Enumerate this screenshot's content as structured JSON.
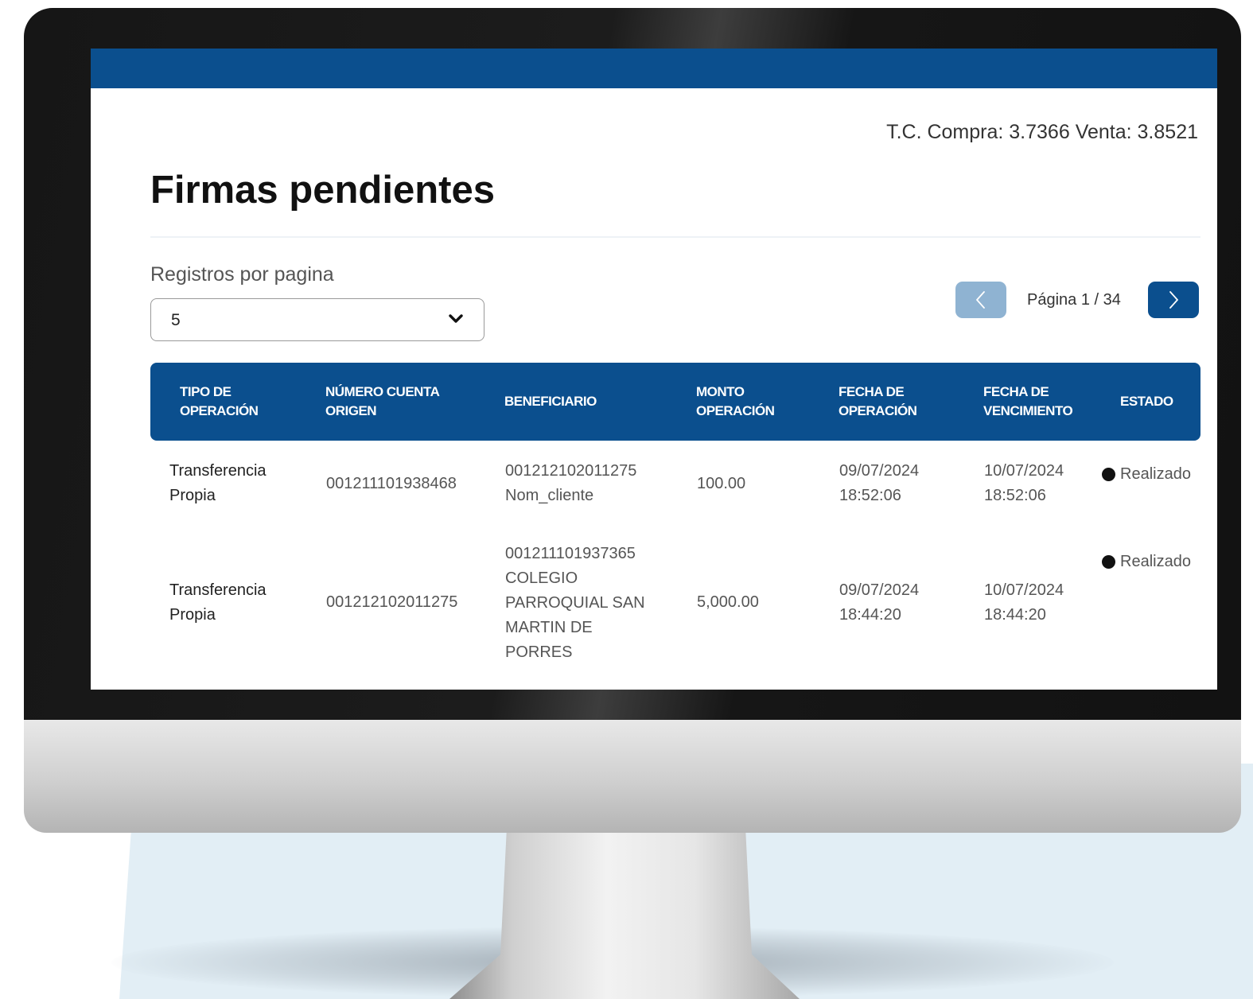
{
  "exchange_rate": "T.C. Compra: 3.7366 Venta: 3.8521",
  "page": {
    "title": "Firmas pendientes"
  },
  "controls": {
    "records_per_page_label": "Registros por pagina",
    "records_per_page_value": "5",
    "pagination_label": "Página 1 / 34"
  },
  "table": {
    "headers": [
      "TIPO DE\nOPERACIÓN",
      "NÚMERO CUENTA\nORIGEN",
      "BENEFICIARIO",
      "MONTO\nOPERACIÓN",
      "FECHA DE\nOPERACIÓN",
      "FECHA DE\nVENCIMIENTO",
      "ESTADO"
    ],
    "rows": [
      {
        "tipo": "Transferencia\nPropia",
        "cuenta": "001211101938468",
        "beneficiario": "001212102011275\nNom_cliente",
        "monto": "100.00",
        "fecha_operacion": "09/07/2024\n18:52:06",
        "fecha_vencimiento": "10/07/2024\n18:52:06",
        "estado": "Realizado"
      },
      {
        "tipo": "Transferencia\nPropia",
        "cuenta": "001212102011275",
        "beneficiario": "001211101937365\nCOLEGIO\nPARROQUIAL SAN\nMARTIN DE\nPORRES",
        "monto": "5,000.00",
        "fecha_operacion": "09/07/2024\n18:44:20",
        "fecha_vencimiento": "10/07/2024\n18:44:20",
        "estado": "Realizado"
      }
    ]
  },
  "icons": {
    "select_arrow": "chevron-down-icon",
    "prev": "chevron-left-icon",
    "next": "chevron-right-icon",
    "status": "status-dot-icon"
  },
  "colors": {
    "brand_blue": "#0b4f8e",
    "disabled_blue": "#8fb3d2",
    "background_accent": "#e2eef5"
  }
}
